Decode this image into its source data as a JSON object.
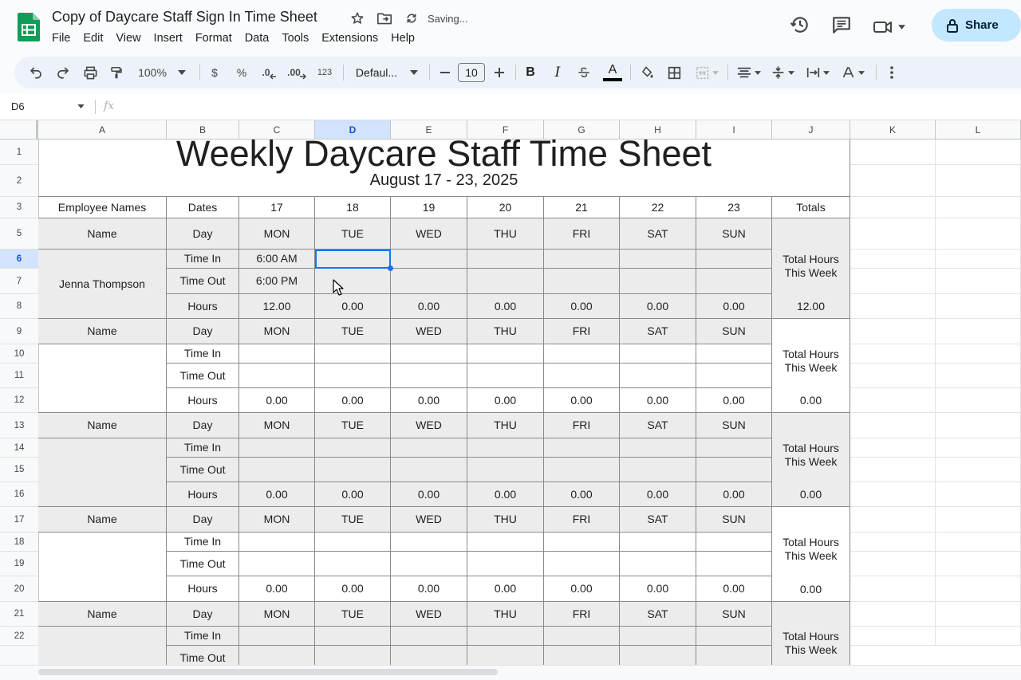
{
  "doc": {
    "title": "Copy of Daycare Staff Sign In Time Sheet",
    "status": "Saving..."
  },
  "menu": [
    "File",
    "Edit",
    "View",
    "Insert",
    "Format",
    "Data",
    "Tools",
    "Extensions",
    "Help"
  ],
  "share_label": "Share",
  "toolbar": {
    "zoom": "100%",
    "currency": "$",
    "percent": "%",
    "dec_decrease": ".0",
    "dec_increase": ".00",
    "number_format": "123",
    "font": "Defaul...",
    "font_size": "10",
    "bold": "B",
    "italic": "I",
    "text_color": "A"
  },
  "formula_bar": {
    "cell_ref": "D6",
    "fx": "fx",
    "value": ""
  },
  "columns": [
    "A",
    "B",
    "C",
    "D",
    "E",
    "F",
    "G",
    "H",
    "I",
    "J",
    "K",
    "L"
  ],
  "rows": [
    "1",
    "2",
    "3",
    "5",
    "6",
    "7",
    "8",
    "9",
    "10",
    "11",
    "12",
    "13",
    "14",
    "15",
    "16",
    "17",
    "18",
    "19",
    "20",
    "21",
    "22"
  ],
  "selected_cell": "D6",
  "sheet": {
    "title": "Weekly Daycare Staff Time Sheet",
    "subtitle": "August 17 - 23, 2025",
    "header": {
      "employee_names": "Employee Names",
      "dates": "Dates",
      "day_numbers": [
        "17",
        "18",
        "19",
        "20",
        "21",
        "22",
        "23"
      ],
      "totals": "Totals"
    },
    "labels": {
      "name": "Name",
      "day": "Day",
      "time_in": "Time In",
      "time_out": "Time Out",
      "hours": "Hours",
      "total_hours": "Total Hours This Week"
    },
    "weekdays": [
      "MON",
      "TUE",
      "WED",
      "THU",
      "FRI",
      "SAT",
      "SUN"
    ],
    "employees": [
      {
        "name": "Jenna Thompson",
        "time_in": [
          "6:00 AM",
          "",
          "",
          "",
          "",
          "",
          ""
        ],
        "time_out": [
          "6:00 PM",
          "",
          "",
          "",
          "",
          "",
          ""
        ],
        "hours": [
          "12.00",
          "0.00",
          "0.00",
          "0.00",
          "0.00",
          "0.00",
          "0.00"
        ],
        "total": "12.00"
      },
      {
        "name": "",
        "time_in": [
          "",
          "",
          "",
          "",
          "",
          "",
          ""
        ],
        "time_out": [
          "",
          "",
          "",
          "",
          "",
          "",
          ""
        ],
        "hours": [
          "0.00",
          "0.00",
          "0.00",
          "0.00",
          "0.00",
          "0.00",
          "0.00"
        ],
        "total": "0.00"
      },
      {
        "name": "",
        "time_in": [
          "",
          "",
          "",
          "",
          "",
          "",
          ""
        ],
        "time_out": [
          "",
          "",
          "",
          "",
          "",
          "",
          ""
        ],
        "hours": [
          "0.00",
          "0.00",
          "0.00",
          "0.00",
          "0.00",
          "0.00",
          "0.00"
        ],
        "total": "0.00"
      },
      {
        "name": "",
        "time_in": [
          "",
          "",
          "",
          "",
          "",
          "",
          ""
        ],
        "time_out": [
          "",
          "",
          "",
          "",
          "",
          "",
          ""
        ],
        "hours": [
          "0.00",
          "0.00",
          "0.00",
          "0.00",
          "0.00",
          "0.00",
          "0.00"
        ],
        "total": "0.00"
      },
      {
        "name": "",
        "time_in": [
          "",
          "",
          "",
          "",
          "",
          "",
          ""
        ],
        "time_out": [
          "",
          "",
          "",
          "",
          "",
          "",
          ""
        ],
        "hours": [],
        "total": ""
      }
    ]
  },
  "colors": {
    "accent": "#1a73e8",
    "share_bg": "#c2e7ff",
    "block_gray": "#ececec",
    "sheets_green": "#0f9d58"
  }
}
